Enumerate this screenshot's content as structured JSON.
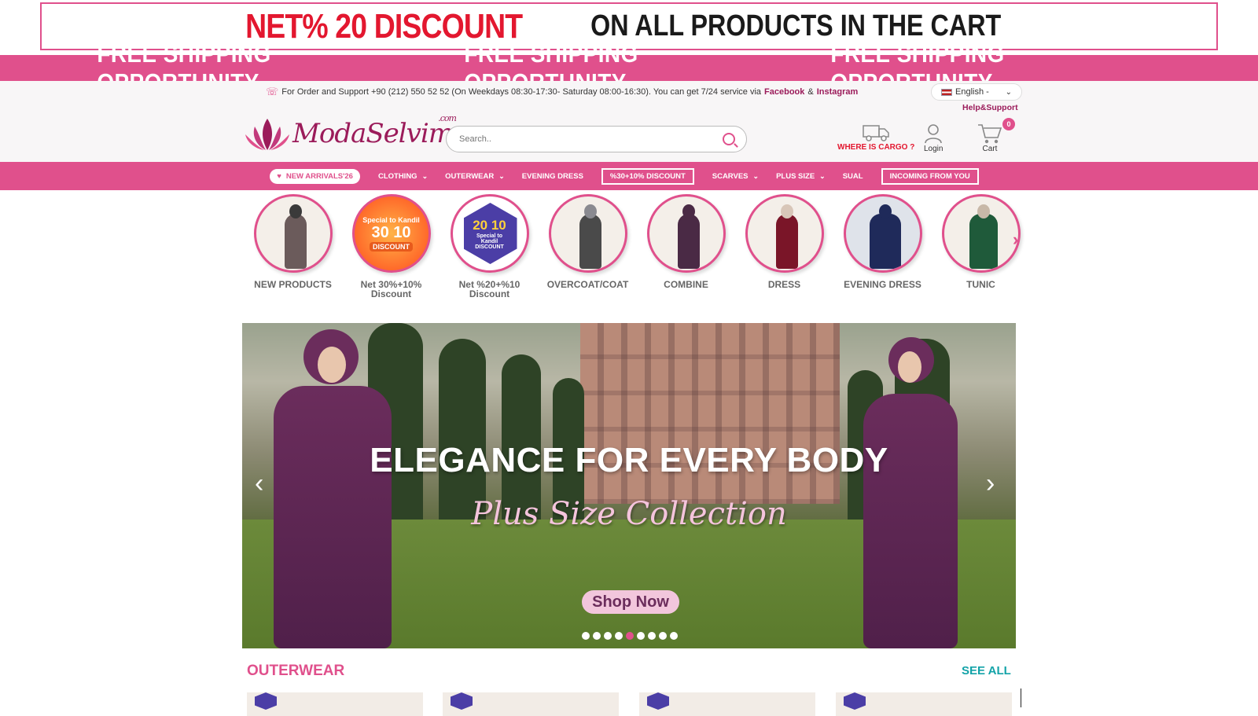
{
  "top_banner": {
    "red_text": "NET% 20 DISCOUNT",
    "black_text": "ON ALL PRODUCTS IN THE CART"
  },
  "shipping_strip": [
    "FREE SHIPPING OPPORTUNITY",
    "FREE SHIPPING OPPORTUNITY",
    "FREE SHIPPING OPPORTUNITY"
  ],
  "support": {
    "text": "For Order and Support +90 (212) 550 52 52 (On Weekdays 08:30-17:30- Saturday 08:00-16:30). You can get 7/24 service via",
    "facebook": "Facebook",
    "amp": "&",
    "instagram": "Instagram"
  },
  "language": {
    "selected": "English -"
  },
  "help_label": "Help&Support",
  "logo": {
    "text": "ModaSelvim",
    "suffix": ".com"
  },
  "search": {
    "placeholder": "Search.."
  },
  "header_icons": {
    "cargo": "WHERE IS CARGO ?",
    "login": "Login",
    "cart": "Cart",
    "cart_count": "0"
  },
  "nav": {
    "new_arrivals": "NEW ARRIVALS'26",
    "clothing": "CLOTHING",
    "outerwear": "OUTERWEAR",
    "evening_dress": "EVENING DRESS",
    "discount": "%30+10% DISCOUNT",
    "scarves": "SCARVES",
    "plus_size": "PLUS SIZE",
    "sual": "SUAL",
    "incoming": "INCOMING FROM YOU"
  },
  "categories": [
    {
      "label": "NEW PRODUCTS"
    },
    {
      "label": "Net 30%+10% Discount",
      "badge_top": "Special to Kandil",
      "badge_nums": "30 10",
      "badge_bottom": "DISCOUNT"
    },
    {
      "label": "Net %20+%10 Discount",
      "badge_nums": "20 10",
      "badge_bottom": "Special to Kandil DISCOUNT"
    },
    {
      "label": "OVERCOAT/COAT"
    },
    {
      "label": "COMBINE"
    },
    {
      "label": "DRESS"
    },
    {
      "label": "EVENING DRESS"
    },
    {
      "label": "TUNIC"
    }
  ],
  "hero": {
    "title": "ELEGANCE FOR EVERY BODY",
    "subtitle": "Plus Size Collection",
    "button": "Shop Now",
    "slide_count": 9,
    "active_slide": 5
  },
  "section": {
    "title": "OUTERWEAR",
    "see_all": "SEE ALL"
  },
  "colors": {
    "brand_pink": "#e0508c",
    "brand_plum": "#9b1b5a",
    "accent_teal": "#13a3a8",
    "alert_red": "#e3172f"
  }
}
